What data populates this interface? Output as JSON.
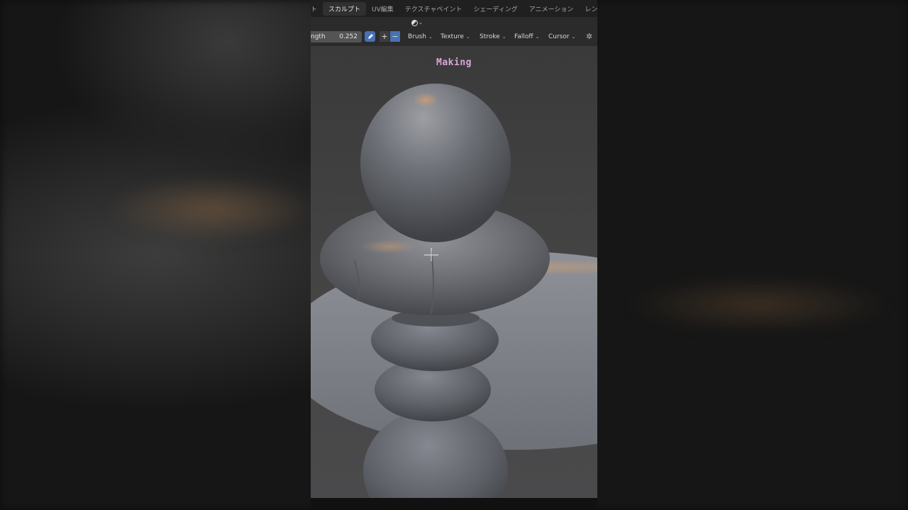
{
  "workspace_tabs": [
    {
      "label": "ト",
      "active": false
    },
    {
      "label": "スカルプト",
      "active": true
    },
    {
      "label": "UV編集",
      "active": false
    },
    {
      "label": "テクスチャペイント",
      "active": false
    },
    {
      "label": "シェーディング",
      "active": false
    },
    {
      "label": "アニメーション",
      "active": false
    },
    {
      "label": "レンダリ",
      "active": false
    }
  ],
  "tool_header": {
    "strength_label": "ngth",
    "strength_value": "0.252",
    "plus_glyph": "+",
    "minus_glyph": "−",
    "brush_label": "Brush",
    "texture_label": "Texture",
    "stroke_label": "Stroke",
    "falloff_label": "Falloff",
    "cursor_label": "Cursor"
  },
  "viewport": {
    "overlay_text": "Making"
  },
  "colors": {
    "accent_blue": "#4772b3",
    "overlay_text": "#d9a8d4",
    "header_bg": "#2b2b2b",
    "tabs_bg": "#202020"
  },
  "icons": [
    "sculpt-mode-icon",
    "pen-pressure-icon",
    "options-icon",
    "brush-cursor-icon"
  ]
}
